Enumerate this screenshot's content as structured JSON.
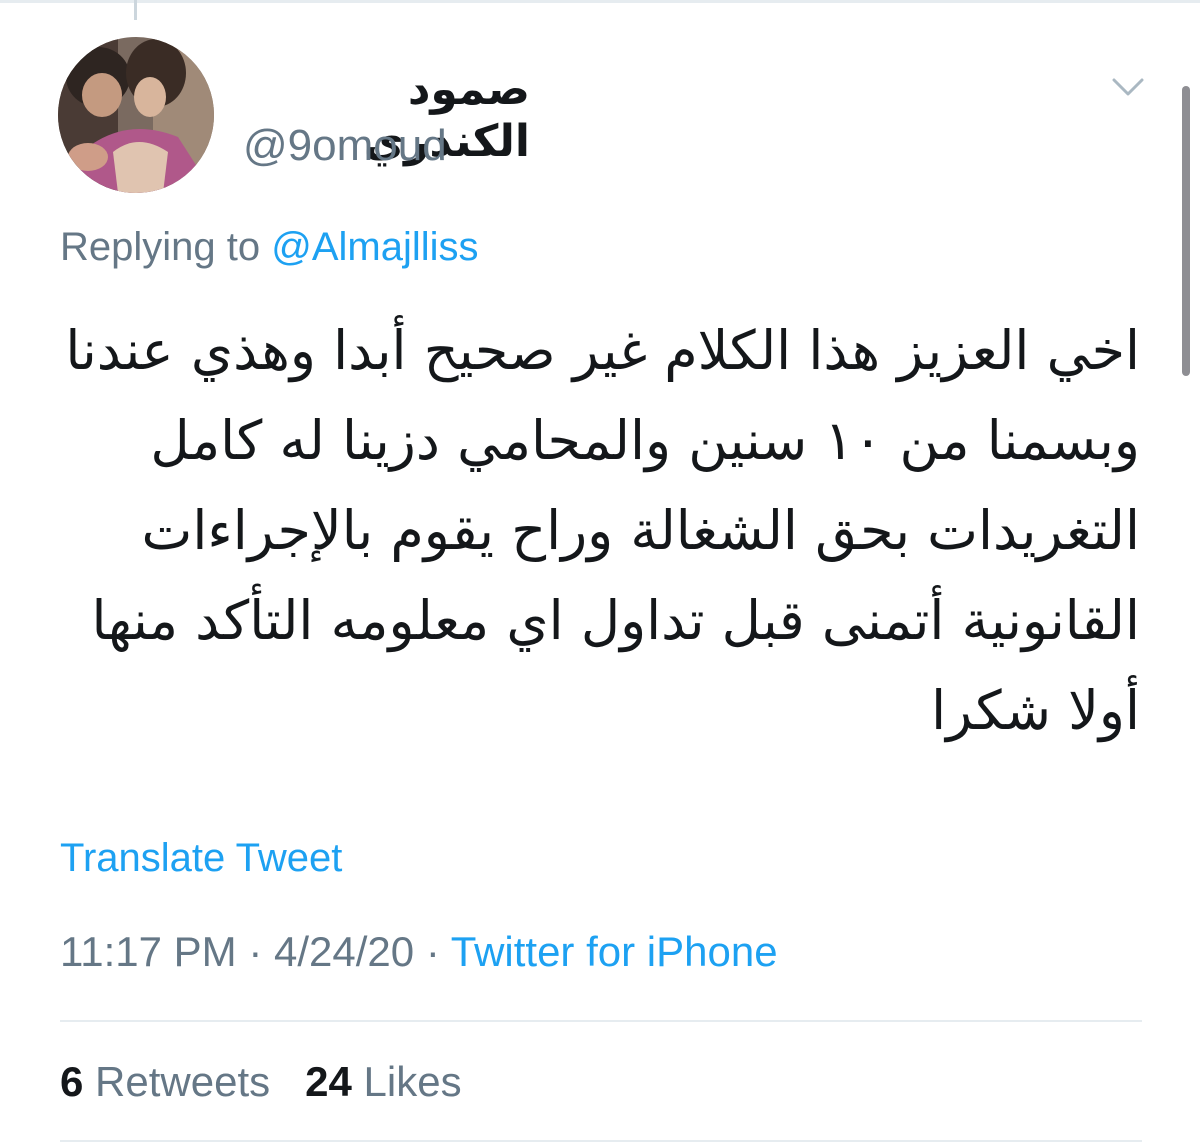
{
  "tweet": {
    "display_name": "صمود الكندري",
    "handle": "@9omoud",
    "replying_prefix": "Replying to",
    "replying_to": "@Almajlliss",
    "text": "اخي العزيز هذا الكلام غير صحيح أبدا وهذي عندنا وبسمنا من ١٠ سنين والمحامي دزينا له كامل التغريدات بحق الشغالة وراح يقوم بالإجراءات القانونية أتمنى قبل تداول اي معلومه التأكد منها أولا شكرا",
    "translate_label": "Translate Tweet",
    "time": "11:17 PM",
    "date": "4/24/20",
    "source": "Twitter for iPhone",
    "separator": "·"
  },
  "stats": {
    "retweets_count": "6",
    "retweets_label": "Retweets",
    "likes_count": "24",
    "likes_label": "Likes"
  },
  "icons": {
    "menu": "chevron-down-icon",
    "avatar": "avatar"
  },
  "colors": {
    "link_blue": "#1da1f2",
    "text_dark": "#14171a",
    "text_gray": "#657786",
    "divider": "#e6ecf0"
  }
}
